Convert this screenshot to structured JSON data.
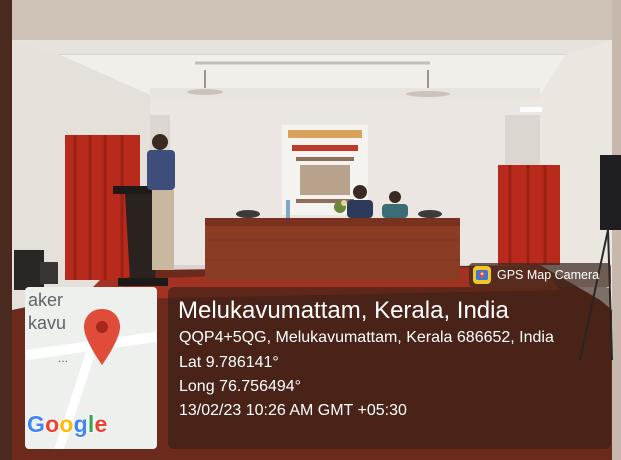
{
  "map": {
    "place_fragment_1": "aker",
    "place_fragment_2": "kavu",
    "dots": "...",
    "pin_icon": "map-pin-icon",
    "logo_letters": [
      {
        "char": "G",
        "color": "#4285F4"
      },
      {
        "char": "o",
        "color": "#EA4335"
      },
      {
        "char": "o",
        "color": "#FBBC05"
      },
      {
        "char": "g",
        "color": "#4285F4"
      },
      {
        "char": "l",
        "color": "#34A853"
      },
      {
        "char": "e",
        "color": "#EA4335"
      }
    ]
  },
  "gps_badge": {
    "icon": "gps-map-camera-icon",
    "label": "GPS Map Camera"
  },
  "location": {
    "title": "Melukavumattam, Kerala, India",
    "address": "QQP4+5QG, Melukavumattam, Kerala 686652, India",
    "lat": "Lat 9.786141°",
    "long": "Long 76.756494°",
    "datetime": "13/02/23 10:26 AM GMT +05:30"
  },
  "colors": {
    "curtain": "#b82a1c",
    "wall": "#e6e0da",
    "table": "#8a3d24",
    "floor": "#6b2a1c",
    "pin": "#e04b3a"
  }
}
